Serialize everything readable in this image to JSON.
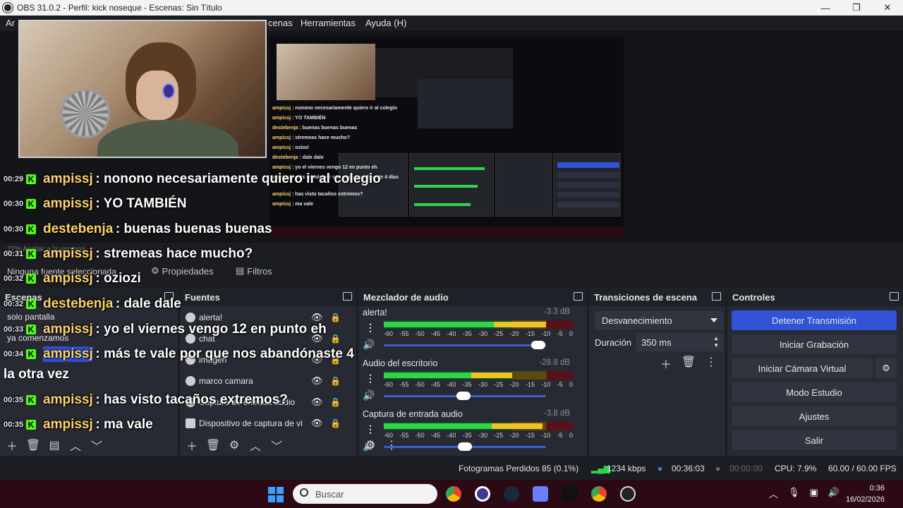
{
  "window": {
    "title": "OBS 31.0.2 - Perfil: kick noseque - Escenas: Sin Título",
    "minimize": "—",
    "maximize": "❐",
    "close": "✕"
  },
  "menu": {
    "partial_left": "Ar",
    "partial_scenes": "cenas",
    "tools": "Herramientas",
    "help": "Ayuda (H)"
  },
  "chat": [
    {
      "time": "00:29",
      "user": "ampissj",
      "msg": ": nonono necesariamente quiero ir al colegio"
    },
    {
      "time": "00:30",
      "user": "ampissj",
      "msg": ": YO TAMBIÉN"
    },
    {
      "time": "00:30",
      "user": "destebenja",
      "msg": ": buenas buenas buenas"
    },
    {
      "time": "00:31",
      "user": "ampissj",
      "msg": ": stremeas hace mucho?"
    },
    {
      "time": "00:32",
      "user": "ampissj",
      "msg": ": oziozi"
    },
    {
      "time": "00:32",
      "user": "destebenja",
      "msg": ": dale dale"
    },
    {
      "time": "00:33",
      "user": "ampissj",
      "msg": ": yo el viernes vengo 12 en punto eh"
    },
    {
      "time": "00:34",
      "user": "ampissj",
      "msg": ": más te vale por que nos abandónaste 4 días"
    },
    {
      "time": "00:35",
      "user": "ampissj",
      "msg": ": has visto tacaños extremos?"
    },
    {
      "time": "00:35",
      "user": "ampissj",
      "msg": ": ma vale"
    }
  ],
  "chat_wrap": "la otra vez",
  "zoom_hint": "27%    Ajustar a la ventana",
  "source_toolbar": {
    "no_source": "Ninguna fuente seleccionada",
    "properties": "Propiedades",
    "filters": "Filtros"
  },
  "scenes": {
    "title": "Escenas",
    "items": [
      "solo pantalla",
      "ya comenzamos"
    ]
  },
  "sources": {
    "title": "Fuentes",
    "items": [
      "alerta!",
      "chat",
      "imagen",
      "marco camara",
      "Captura de entrada audio",
      "Dispositivo de captura de vi"
    ]
  },
  "mixer": {
    "title": "Mezclador de audio",
    "ticks": [
      "-60",
      "-55",
      "-50",
      "-45",
      "-40",
      "-35",
      "-30",
      "-25",
      "-20",
      "-15",
      "-10",
      "-5",
      "0"
    ],
    "channels": [
      {
        "name": "alerta!",
        "db": "-3.3 dB",
        "level": 0.86,
        "volume": 0.95
      },
      {
        "name": "Audio del escritorio",
        "db": "-28.8 dB",
        "level": 0.68,
        "volume": 0.49
      },
      {
        "name": "Captura de entrada audio",
        "db": "-3.8 dB",
        "level": 0.84,
        "volume": 0.5
      }
    ]
  },
  "transitions": {
    "title": "Transiciones de escena",
    "selected": "Desvanecimiento",
    "duration_label": "Duración",
    "duration_value": "350 ms"
  },
  "controls": {
    "title": "Controles",
    "stop_stream": "Detener Transmisión",
    "start_recording": "Iniciar Grabación",
    "start_virtual_cam": "Iniciar Cámara Virtual",
    "studio_mode": "Modo Estudio",
    "settings": "Ajustes",
    "exit": "Salir"
  },
  "status": {
    "dropped_frames": "Fotogramas Perdidos 85 (0.1%)",
    "bitrate": "1234 kbps",
    "stream_time": "00:36:03",
    "record_time": "00:00:00",
    "cpu": "CPU: 7.9%",
    "fps": "60.00 / 60.00 FPS"
  },
  "taskbar": {
    "search_placeholder": "Buscar",
    "time": "0:36",
    "date": "16/02/2026"
  },
  "colors": {
    "accent": "#3153d6",
    "kick_green": "#53fc18",
    "username": "#ffd26a",
    "panel": "#272a33"
  }
}
